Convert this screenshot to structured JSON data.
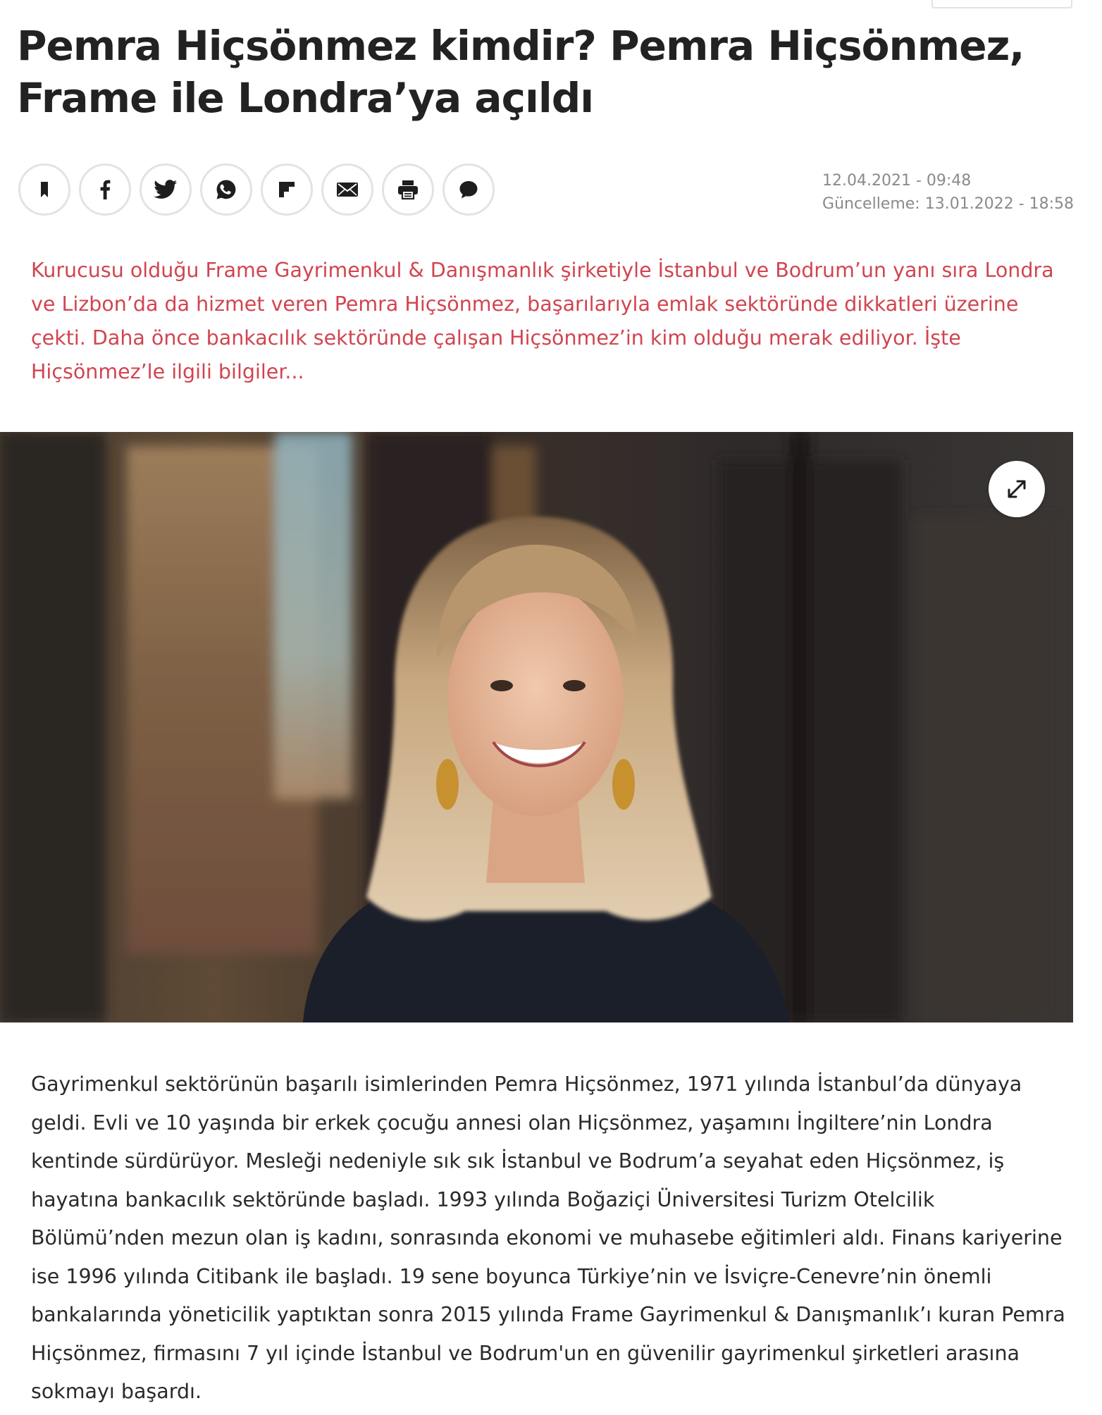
{
  "article": {
    "title": "Pemra Hiçsönmez kimdir? Pemra Hiçsönmez, Frame ile Londra’ya açıldı",
    "published": "12.04.2021 - 09:48",
    "updated": "Güncelleme: 13.01.2022 - 18:58",
    "lead": "Kurucusu olduğu Frame Gayrimenkul & Danışmanlık şirketiyle İstanbul ve Bodrum’un yanı sıra Londra ve Lizbon’da da hizmet veren Pemra Hiçsönmez, başarılarıyla emlak sektöründe dikkatleri üzerine çekti. Daha önce bankacılık sektöründe çalışan Hiçsönmez’in kim olduğu merak ediliyor. İşte Hiçsönmez’le ilgili bilgiler...",
    "body": "Gayrimenkul sektörünün başarılı isimlerinden Pemra Hiçsönmez, 1971 yılında İstanbul’da dünyaya geldi. Evli ve 10 yaşında bir erkek çocuğu annesi olan Hiçsönmez, yaşamını İngiltere’nin Londra kentinde sürdürüyor. Mesleği nedeniyle sık sık İstanbul ve Bodrum’a seyahat eden Hiçsönmez, iş hayatına bankacılık sektöründe başladı. 1993 yılında Boğaziçi Üniversitesi Turizm Otelcilik Bölümü’nden mezun olan iş kadını, sonrasında ekonomi ve muhasebe eğitimleri aldı. Finans kariyerine ise 1996 yılında Citibank ile başladı. 19 sene boyunca Türkiye’nin ve İsviçre-Cenevre’nin önemli bankalarında yöneticilik yaptıktan sonra 2015 yılında Frame Gayrimenkul & Danışmanlık’ı kuran Pemra Hiçsönmez, firmasını 7 yıl içinde İstanbul ve Bodrum'un en güvenilir gayrimenkul şirketleri arasına sokmayı başardı."
  },
  "share_buttons": [
    {
      "icon": "bookmark-icon"
    },
    {
      "icon": "facebook-icon"
    },
    {
      "icon": "twitter-icon"
    },
    {
      "icon": "whatsapp-icon"
    },
    {
      "icon": "flipboard-icon"
    },
    {
      "icon": "email-icon"
    },
    {
      "icon": "print-icon"
    },
    {
      "icon": "comment-icon"
    }
  ],
  "hero_image": {
    "expand_icon": "expand-icon"
  },
  "colors": {
    "lead_text": "#d04550",
    "headline": "#222222",
    "meta_text": "#8a8a8a",
    "button_border": "#e3e3e3",
    "icon": "#1e1e1e"
  }
}
